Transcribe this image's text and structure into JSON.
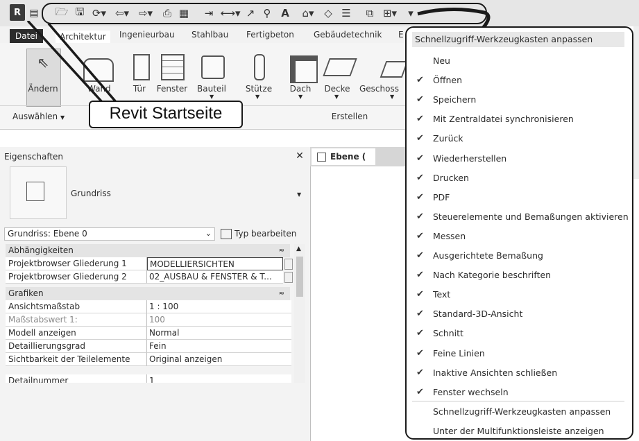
{
  "tabs": [
    "Datei",
    "Architektur",
    "Ingenieurbau",
    "Stahlbau",
    "Fertigbeton",
    "Gebäudetechnik",
    "E"
  ],
  "ribbon": {
    "tools": [
      "Ändern",
      "Wand",
      "Tür",
      "Fenster",
      "Bauteil",
      "Stütze",
      "Dach",
      "Decke",
      "Geschoss"
    ],
    "select_label": "Auswählen",
    "create_label": "Erstellen"
  },
  "callout": "Revit Startseite",
  "properties": {
    "title": "Eigenschaften",
    "family": "Grundriss",
    "selector": "Grundriss: Ebene 0",
    "edit_type": "Typ bearbeiten",
    "groups": [
      {
        "name": "Abhängigkeiten",
        "rows": [
          {
            "label": "Projektbrowser Gliederung 1",
            "value": "MODELLIERSICHTEN"
          },
          {
            "label": "Projektbrowser Gliederung 2",
            "value": "02_AUSBAU & FENSTER & T..."
          }
        ]
      },
      {
        "name": "Grafiken",
        "rows": [
          {
            "label": "Ansichtsmaßstab",
            "value": "1 : 100"
          },
          {
            "label": "Maßstabswert 1:",
            "value": "100"
          },
          {
            "label": "Modell anzeigen",
            "value": "Normal"
          },
          {
            "label": "Detaillierungsgrad",
            "value": "Fein"
          },
          {
            "label": "Sichtbarkeit der Teilelemente",
            "value": "Original anzeigen"
          },
          {
            "label": "Detailnummer",
            "value": "1"
          }
        ]
      }
    ]
  },
  "view_tab": "Ebene (",
  "menu": {
    "header": "Schnellzugriff-Werkzeugkasten anpassen",
    "items": [
      {
        "label": "Neu",
        "checked": false
      },
      {
        "label": "Öffnen",
        "checked": true
      },
      {
        "label": "Speichern",
        "checked": true
      },
      {
        "label": "Mit Zentraldatei synchronisieren",
        "checked": true
      },
      {
        "label": "Zurück",
        "checked": true
      },
      {
        "label": "Wiederherstellen",
        "checked": true
      },
      {
        "label": "Drucken",
        "checked": true
      },
      {
        "label": "PDF",
        "checked": true
      },
      {
        "label": "Steuerelemente und Bemaßungen aktivieren",
        "checked": true
      },
      {
        "label": "Messen",
        "checked": true
      },
      {
        "label": "Ausgerichtete Bemaßung",
        "checked": true
      },
      {
        "label": "Nach Kategorie beschriften",
        "checked": true
      },
      {
        "label": "Text",
        "checked": true
      },
      {
        "label": "Standard-3D-Ansicht",
        "checked": true
      },
      {
        "label": "Schnitt",
        "checked": true
      },
      {
        "label": "Feine Linien",
        "checked": true
      },
      {
        "label": "Inaktive Ansichten schließen",
        "checked": true
      },
      {
        "label": "Fenster wechseln",
        "checked": true
      }
    ],
    "footer": [
      "Schnellzugriff-Werkzeugkasten anpassen",
      "Unter der Multifunktionsleiste anzeigen"
    ]
  }
}
